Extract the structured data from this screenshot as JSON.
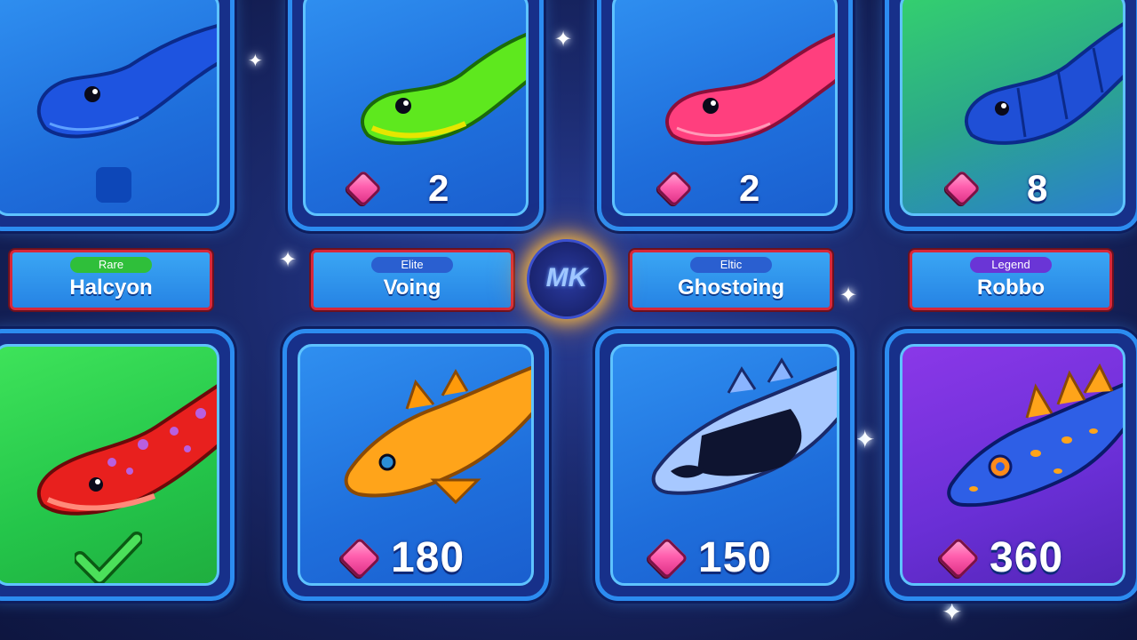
{
  "top_row": [
    {
      "id": "halcyon-snake",
      "bg": "blue",
      "price": null,
      "owned_marker": "checkbox"
    },
    {
      "id": "voing-snake",
      "bg": "blue",
      "price": "2"
    },
    {
      "id": "ghostoing-snake",
      "bg": "blue",
      "price": "2"
    },
    {
      "id": "robbo-snake",
      "bg": "teal",
      "price": "8"
    }
  ],
  "labels": [
    {
      "rarity": "Rare",
      "rarity_color": "#2fbf3a",
      "name": "Halcyon"
    },
    {
      "rarity": "Elite",
      "rarity_color": "#2a5fd0",
      "name": "Voing"
    },
    {
      "rarity": "Eltic",
      "rarity_color": "#2a5fd0",
      "name": "Ghostoing"
    },
    {
      "rarity": "Legend",
      "rarity_color": "#6a35d6",
      "name": "Robbo"
    }
  ],
  "bottom_row": [
    {
      "id": "red-lizard",
      "bg": "green",
      "price": null,
      "status_icon": "checkmark-icon"
    },
    {
      "id": "orange-fish",
      "bg": "blue",
      "price": "180"
    },
    {
      "id": "koi-fish",
      "bg": "blue",
      "price": "150"
    },
    {
      "id": "spiky-fish",
      "bg": "purple",
      "price": "360"
    }
  ],
  "logo": {
    "text": "MK"
  },
  "currency_icon": "pink-gem-icon",
  "colors": {
    "card_border": "#2c8cf0",
    "label_border": "#d8283a",
    "gem": "#ff5fae"
  }
}
